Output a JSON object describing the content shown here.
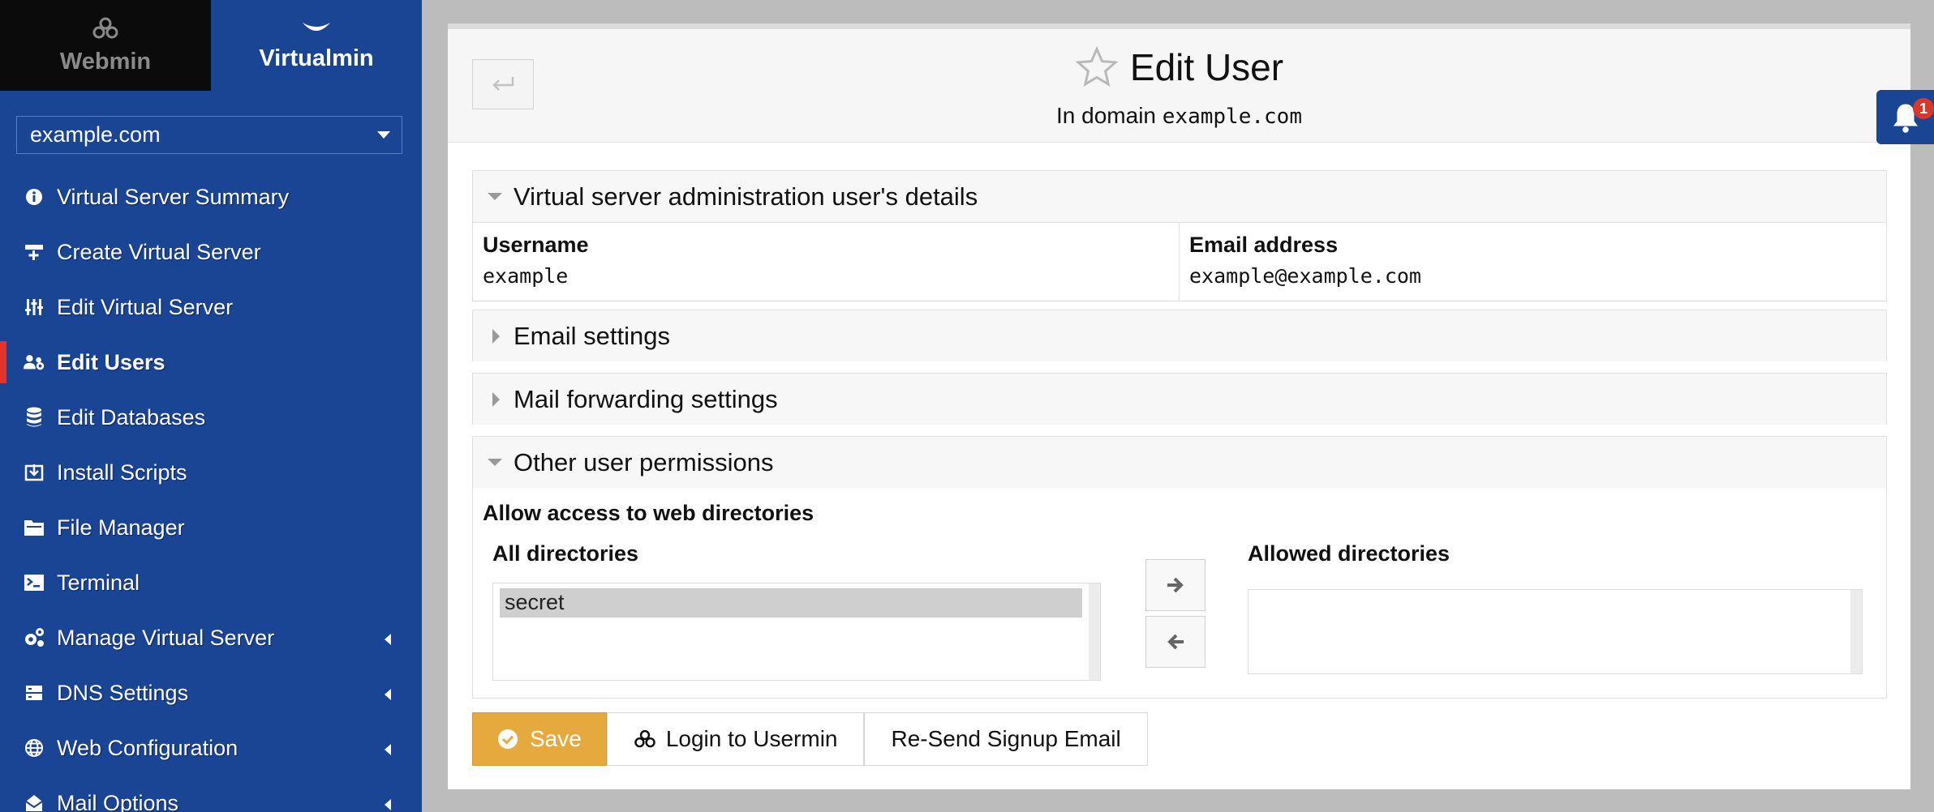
{
  "top_tabs": {
    "webmin": "Webmin",
    "virtualmin": "Virtualmin"
  },
  "domain_select": {
    "value": "example.com"
  },
  "nav": {
    "items": [
      {
        "label": "Virtual Server Summary",
        "icon": "info-icon"
      },
      {
        "label": "Create Virtual Server",
        "icon": "create-server-icon"
      },
      {
        "label": "Edit Virtual Server",
        "icon": "sliders-icon"
      },
      {
        "label": "Edit Users",
        "icon": "users-gear-icon",
        "active": true
      },
      {
        "label": "Edit Databases",
        "icon": "database-icon"
      },
      {
        "label": "Install Scripts",
        "icon": "install-icon"
      },
      {
        "label": "File Manager",
        "icon": "folder-icon"
      },
      {
        "label": "Terminal",
        "icon": "terminal-icon"
      },
      {
        "label": "Manage Virtual Server",
        "icon": "gears-icon",
        "submenu": true
      },
      {
        "label": "DNS Settings",
        "icon": "server-icon",
        "submenu": true
      },
      {
        "label": "Web Configuration",
        "icon": "globe-icon",
        "submenu": true
      },
      {
        "label": "Mail Options",
        "icon": "envelope-open-icon",
        "submenu": true
      }
    ]
  },
  "header": {
    "title": "Edit User",
    "subtitle_prefix": "In domain",
    "subtitle_domain": "example.com"
  },
  "sections": {
    "details": {
      "title": "Virtual server administration user's details",
      "username_label": "Username",
      "username_value": "example",
      "email_label": "Email address",
      "email_value": "example@example.com"
    },
    "email_settings": {
      "title": "Email settings"
    },
    "mail_forwarding": {
      "title": "Mail forwarding settings"
    },
    "permissions": {
      "title": "Other user permissions",
      "web_dirs_label": "Allow access to web directories",
      "all_dirs_label": "All directories",
      "allowed_dirs_label": "Allowed directories",
      "all_dirs_options": [
        "secret"
      ]
    }
  },
  "buttons": {
    "save": "Save",
    "login_usermin": "Login to Usermin",
    "resend_signup": "Re-Send Signup Email"
  },
  "notifications": {
    "count": "1"
  },
  "colors": {
    "sidebar": "#1a4494",
    "active_marker": "#e5322a",
    "save_button": "#e5a93d",
    "badge": "#d9362c"
  }
}
